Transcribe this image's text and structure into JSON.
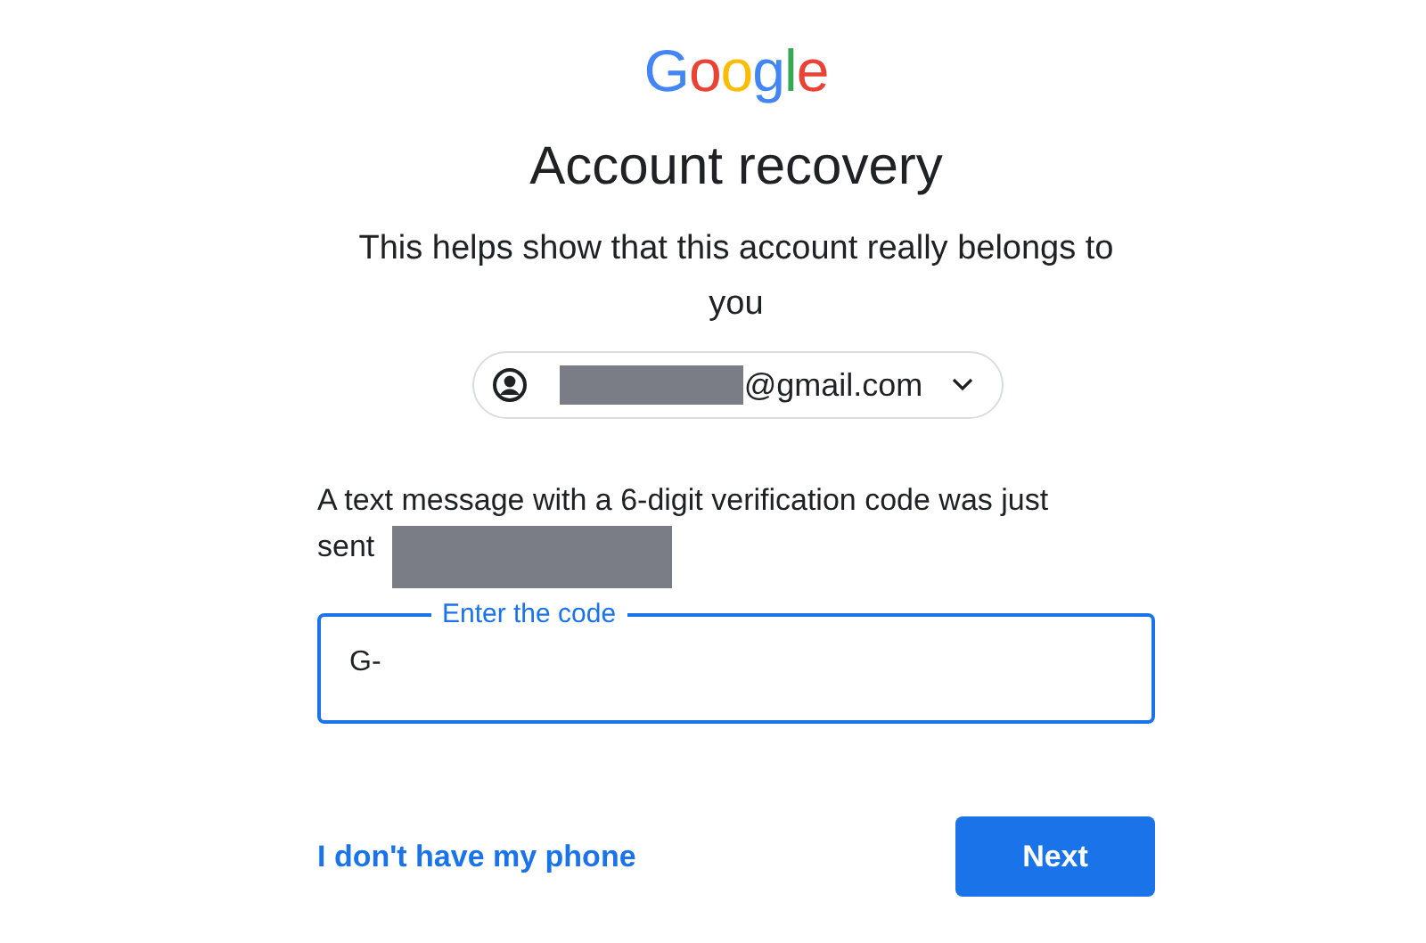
{
  "logo": {
    "text": "Google"
  },
  "title": "Account recovery",
  "subtitle": "This helps show that this account really belongs to you",
  "account_chip": {
    "email": "@gmail.com",
    "redacted": true,
    "expanded": false
  },
  "message": {
    "text": "A text message with a 6-digit verification code was just sent",
    "redacted": true
  },
  "code_field": {
    "label": "Enter the code",
    "value": "G-",
    "focused": true
  },
  "link": "I don't have my phone",
  "button": "Next"
}
